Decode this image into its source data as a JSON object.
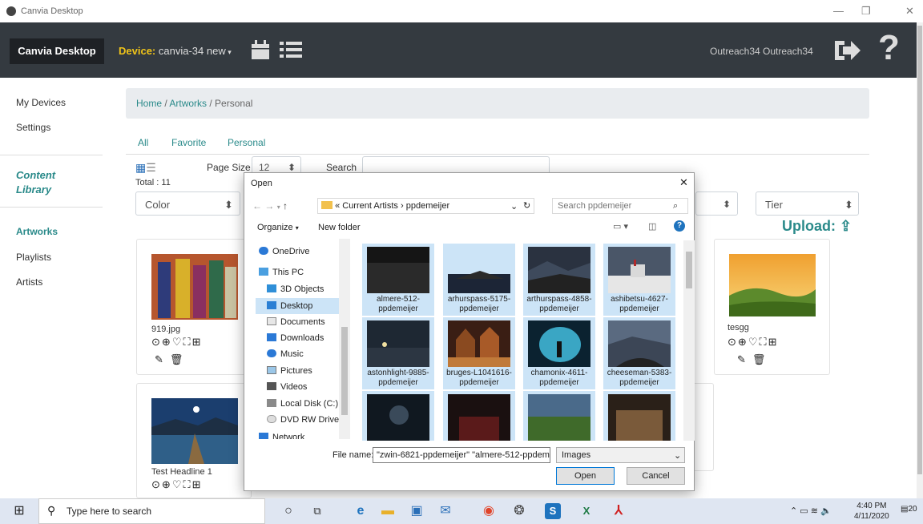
{
  "window": {
    "title": "Canvia Desktop"
  },
  "navbar": {
    "brand": "Canvia Desktop",
    "device_label": "Device:",
    "device_name": "canvia-34 new",
    "user": "Outreach34 Outreach34"
  },
  "sidebar": {
    "my_devices": "My Devices",
    "settings": "Settings",
    "content_library": "Content Library",
    "artworks": "Artworks",
    "playlists": "Playlists",
    "artists": "Artists"
  },
  "breadcrumb": {
    "home": "Home",
    "artworks": "Artworks",
    "current": "Personal"
  },
  "tabs": [
    "All",
    "Favorite",
    "Personal"
  ],
  "controls": {
    "page_size_label": "Page Size",
    "page_size": "12",
    "search_label": "Search",
    "total": "Total : 11",
    "color": "Color",
    "tier": "Tier",
    "upload": "Upload:"
  },
  "cards": [
    {
      "name": "919.jpg"
    },
    {
      "name": "tesgg"
    },
    {
      "name": "Test Headline 1"
    }
  ],
  "dialog": {
    "title": "Open",
    "path": [
      "Current Artists",
      "ppdemeijer"
    ],
    "path_prefix": "«",
    "search_placeholder": "Search ppdemeijer",
    "organize": "Organize",
    "new_folder": "New folder",
    "nav_items": [
      "OneDrive",
      "This PC",
      "3D Objects",
      "Desktop",
      "Documents",
      "Downloads",
      "Music",
      "Pictures",
      "Videos",
      "Local Disk (C:)",
      "DVD RW Drive (E",
      "Network"
    ],
    "files": [
      "almere-512-ppdemeijer",
      "arhurspass-5175-ppdemeijer",
      "arthurspass-4858-ppdemeijer",
      "ashibetsu-4627-ppdemeijer",
      "astonhlight-9885-ppdemeijer",
      "bruges-L1041616-ppdemeijer",
      "chamonix-4611-ppdemeijer",
      "cheeseman-5383-ppdemeijer",
      "",
      "",
      "",
      ""
    ],
    "file_name_label": "File name:",
    "file_name_value": "\"zwin-6821-ppdemeijer\" \"almere-512-ppdem",
    "file_type": "Images",
    "open_button": "Open",
    "cancel_button": "Cancel"
  },
  "taskbar": {
    "search_placeholder": "Type here to search",
    "time": "4:40 PM",
    "date": "4/11/2020",
    "notifications": "20"
  },
  "colors": {
    "navbar": "#343a40",
    "accent": "#2a8a8a",
    "device": "#f0c419"
  }
}
